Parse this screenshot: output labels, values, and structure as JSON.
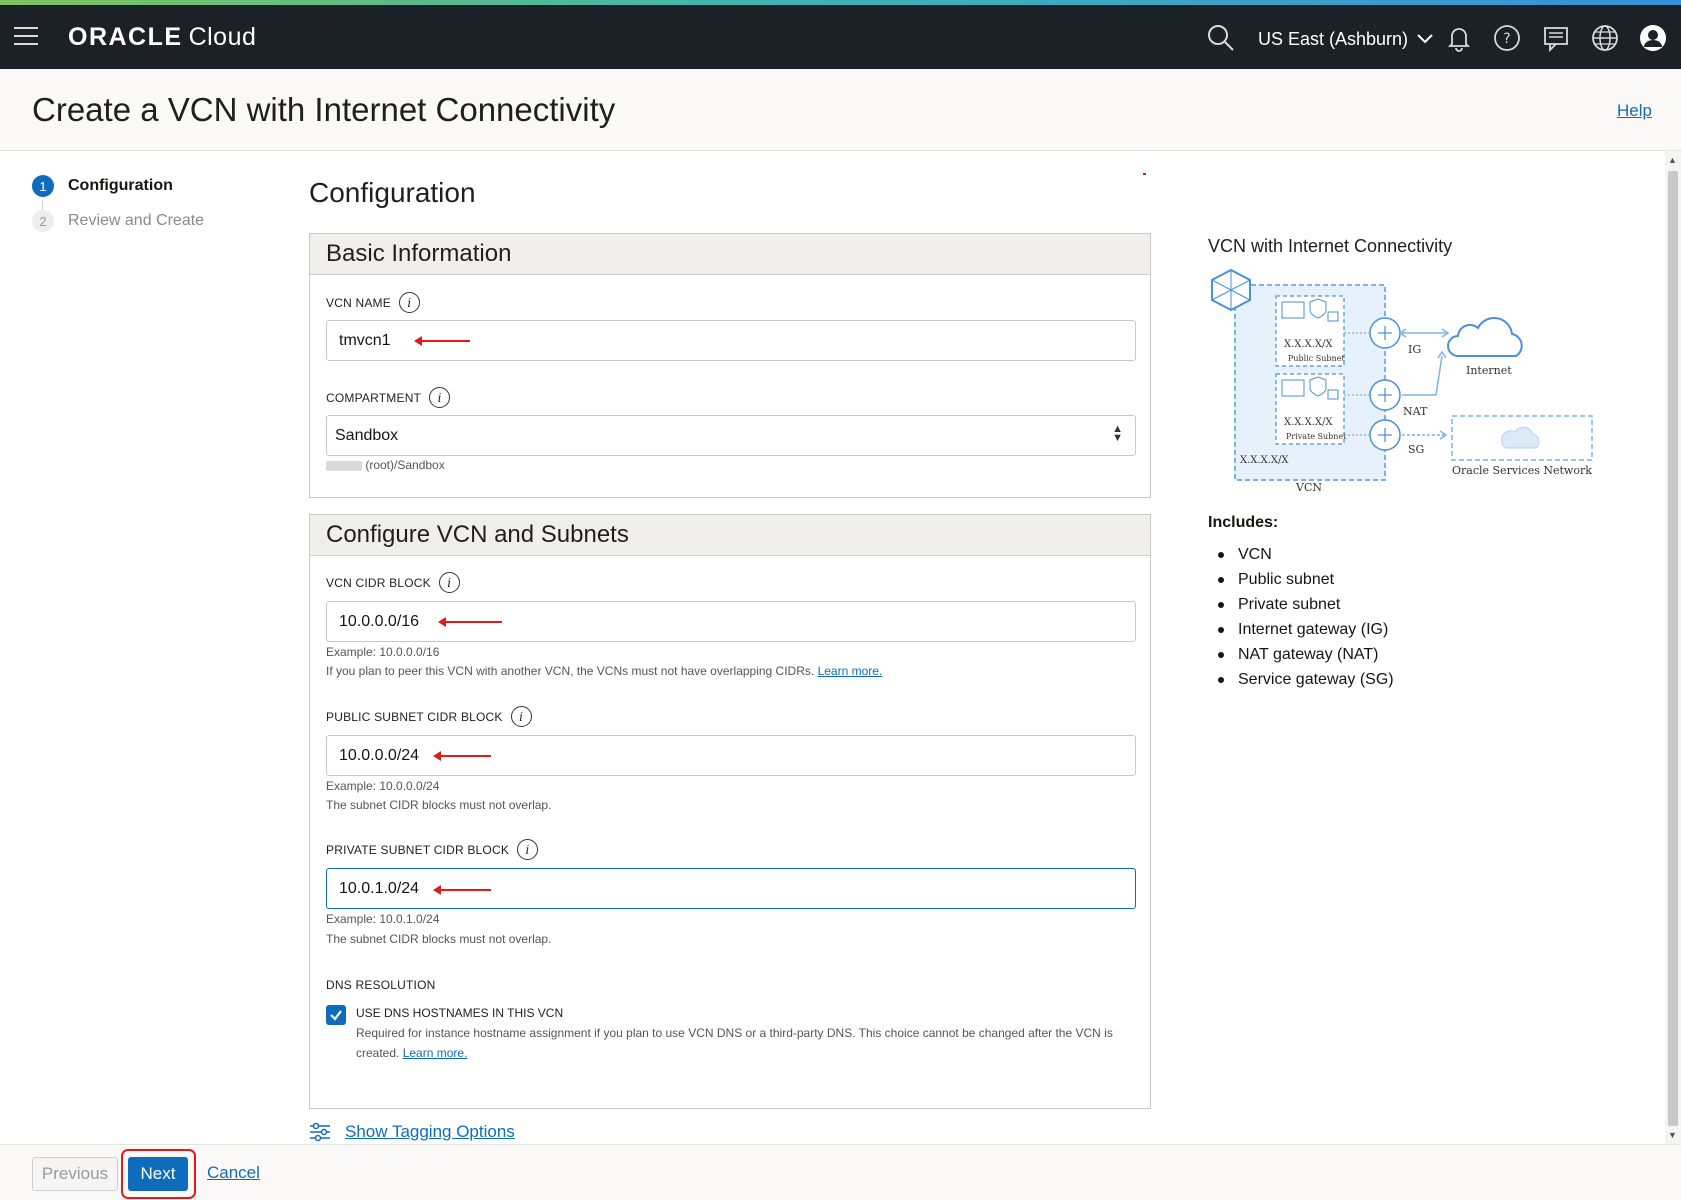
{
  "topbar": {
    "brand_oracle": "ORACLE",
    "brand_cloud": "Cloud",
    "region": "US East (Ashburn)",
    "icons": [
      "menu-icon",
      "search-icon",
      "chevron-down-icon",
      "bell-icon",
      "help-icon",
      "chat-icon",
      "globe-icon",
      "user-icon"
    ]
  },
  "page": {
    "title": "Create a VCN with Internet Connectivity",
    "help_link": "Help"
  },
  "steps": [
    {
      "num": "1",
      "label": "Configuration",
      "active": true
    },
    {
      "num": "2",
      "label": "Review and Create",
      "active": false
    }
  ],
  "main": {
    "title": "Configuration",
    "basic": {
      "header": "Basic Information",
      "vcn_name_label": "VCN NAME",
      "vcn_name_value": "tmvcn1",
      "compartment_label": "COMPARTMENT",
      "compartment_value": "Sandbox",
      "compartment_path": "(root)/Sandbox"
    },
    "configure": {
      "header": "Configure VCN and Subnets",
      "vcn_cidr_label": "VCN CIDR BLOCK",
      "vcn_cidr_value": "10.0.0.0/16",
      "vcn_cidr_example": "Example: 10.0.0.0/16",
      "vcn_cidr_note": "If you plan to peer this VCN with another VCN, the VCNs must not have overlapping CIDRs.",
      "learn_more": "Learn more.",
      "public_label": "PUBLIC SUBNET CIDR BLOCK",
      "public_value": "10.0.0.0/24",
      "public_example": "Example: 10.0.0.0/24",
      "public_note": "The subnet CIDR blocks must not overlap.",
      "private_label": "PRIVATE SUBNET CIDR BLOCK",
      "private_value": "10.0.1.0/24",
      "private_example": "Example: 10.0.1.0/24",
      "private_note": "The subnet CIDR blocks must not overlap.",
      "dns_label": "DNS RESOLUTION",
      "dns_checkbox_label": "USE DNS HOSTNAMES IN THIS VCN",
      "dns_checked": true,
      "dns_note": "Required for instance hostname assignment if you plan to use VCN DNS or a third-party DNS. This choice cannot be changed after the VCN is created.",
      "dns_learn_more": "Learn more."
    },
    "tagging_link": "Show Tagging Options"
  },
  "side": {
    "title": "VCN with Internet Connectivity",
    "diagram_labels": {
      "public_subnet": "Public Subnet",
      "private_subnet": "Private Subnet",
      "cidr": "X.X.X.X/X",
      "vcn": "VCN",
      "ig": "IG",
      "nat": "NAT",
      "sg": "SG",
      "internet": "Internet",
      "osn": "Oracle Services Network"
    },
    "includes_title": "Includes:",
    "includes": [
      "VCN",
      "Public subnet",
      "Private subnet",
      "Internet gateway (IG)",
      "NAT gateway (NAT)",
      "Service gateway (SG)"
    ]
  },
  "footer": {
    "previous": "Previous",
    "next": "Next",
    "cancel": "Cancel"
  },
  "colors": {
    "accent": "#0f6cbd",
    "topbar": "#1b2126",
    "annotation_red": "#e01b1b"
  }
}
